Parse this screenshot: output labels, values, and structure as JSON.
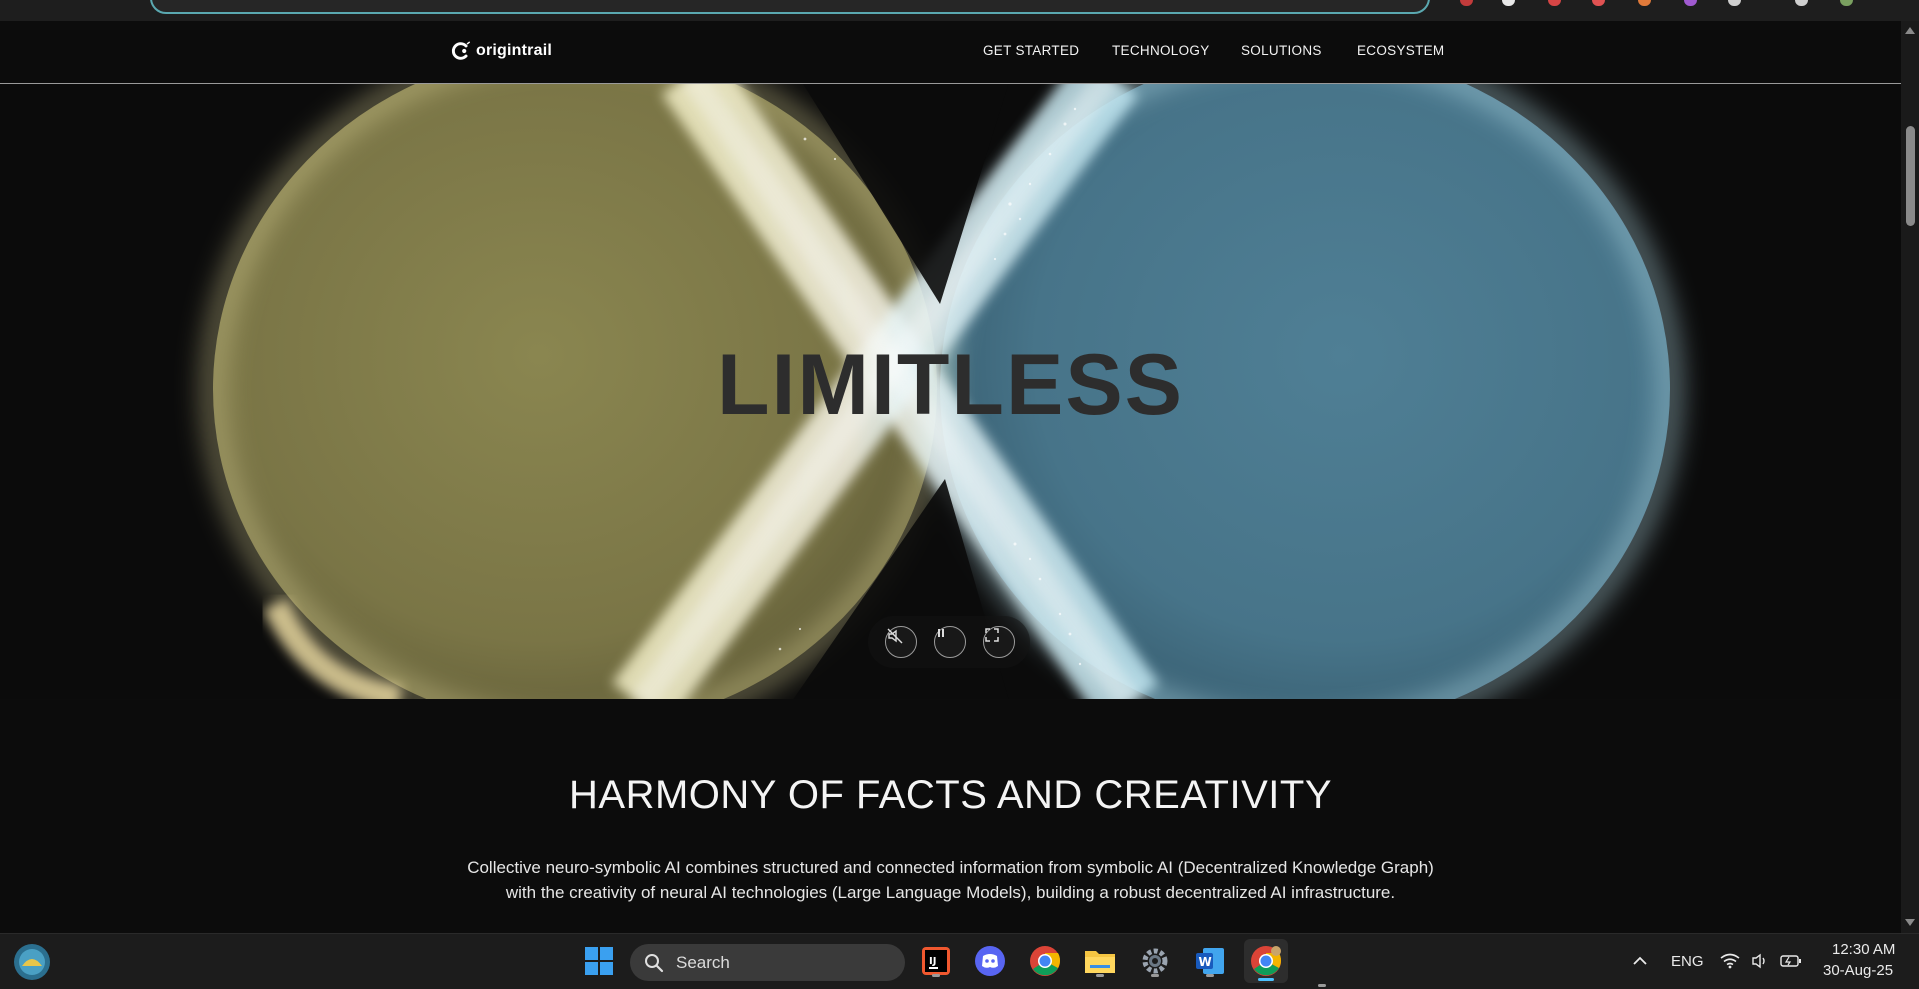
{
  "site": {
    "logo_text": "origintrail"
  },
  "nav": {
    "items": [
      "GET STARTED",
      "TECHNOLOGY",
      "SOLUTIONS",
      "ECOSYSTEM"
    ]
  },
  "hero": {
    "title": "LIMITLESS",
    "controls": [
      "mute-icon",
      "pause-icon",
      "fullscreen-icon"
    ]
  },
  "section": {
    "heading": "HARMONY OF FACTS AND CREATIVITY",
    "line1": "Collective neuro-symbolic AI combines structured and connected information from symbolic AI (Decentralized Knowledge Graph)",
    "line2": "with the creativity of neural AI technologies (Large Language Models), building a robust decentralized AI infrastructure."
  },
  "taskbar": {
    "search_label": "Search",
    "language": "ENG",
    "time": "12:30 AM",
    "date": "30-Aug-25",
    "apps": [
      "windows-start-icon",
      "intellij-icon",
      "discord-icon",
      "chrome-icon",
      "file-explorer-icon",
      "settings-icon",
      "word-icon",
      "chrome-active-icon"
    ]
  },
  "colors": {
    "page_bg": "#0c0c0c",
    "yellow_lobe": "#7d7a4c",
    "blue_lobe": "#4d7a90",
    "accent_teal": "#5aa8b0"
  }
}
